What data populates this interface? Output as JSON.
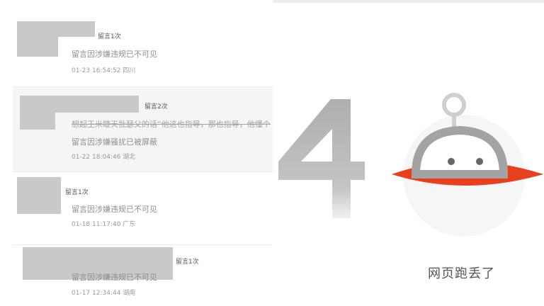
{
  "comments": [
    {
      "count": "留言1次",
      "text": "留言因涉嫌违规已不可见",
      "meta": "01-23 16:54:52 四川"
    },
    {
      "count": "留言2次",
      "struck": "想起王米睫天批瑟父的话“他这也指导，那也指导，他懂个",
      "text": "留言因涉嫌骚扰已被屏蔽",
      "meta": "01-22 18:04:46 湖北"
    },
    {
      "count": "留言1次",
      "text": "留言因涉嫌违规已不可见",
      "meta": "01-18 11:17:40 广东"
    },
    {
      "count": "留言1次",
      "text": "留言因涉嫌违规已不可见",
      "meta": "01-17 12:34:44 湖南"
    }
  ],
  "error_page": {
    "digit": "4",
    "message": "网页跑丢了"
  },
  "colors": {
    "avatar_placeholder": "#c9c9c9",
    "saucer_ring": "#e8401e",
    "digit_gray": "#b8b8b8"
  }
}
